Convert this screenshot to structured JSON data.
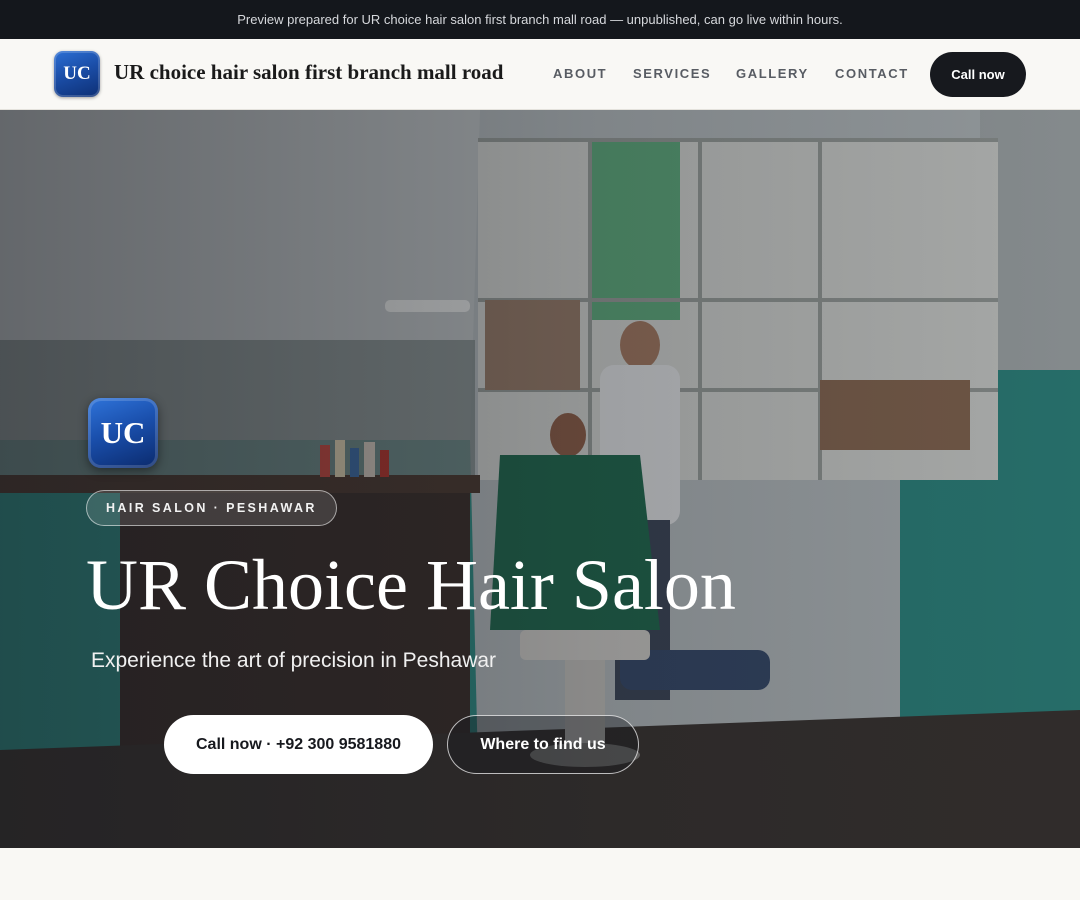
{
  "preview_banner": {
    "text": "Preview prepared for UR choice hair salon first branch mall road — unpublished, can go live within hours."
  },
  "header": {
    "logo_text": "UC",
    "brand_name": "UR choice hair salon first branch mall road",
    "nav": [
      {
        "label": "ABOUT"
      },
      {
        "label": "SERVICES"
      },
      {
        "label": "GALLERY"
      },
      {
        "label": "CONTACT"
      }
    ],
    "cta_label": "Call now"
  },
  "hero": {
    "logo_text": "UC",
    "badge": "HAIR SALON · PESHAWAR",
    "title": "UR Choice Hair Salon",
    "subtitle": "Experience the art of precision in Peshawar",
    "primary_button": "Call now · +92 300 9581880",
    "secondary_button": "Where to find us",
    "background_image": "barber-shop-photo"
  },
  "colors": {
    "preview_bar": "#14171c",
    "header_bg": "#f9f8f5",
    "cta_dark": "#17191e",
    "brand_blue": "#1b4ea8",
    "wall_teal": "#2f8f86"
  }
}
